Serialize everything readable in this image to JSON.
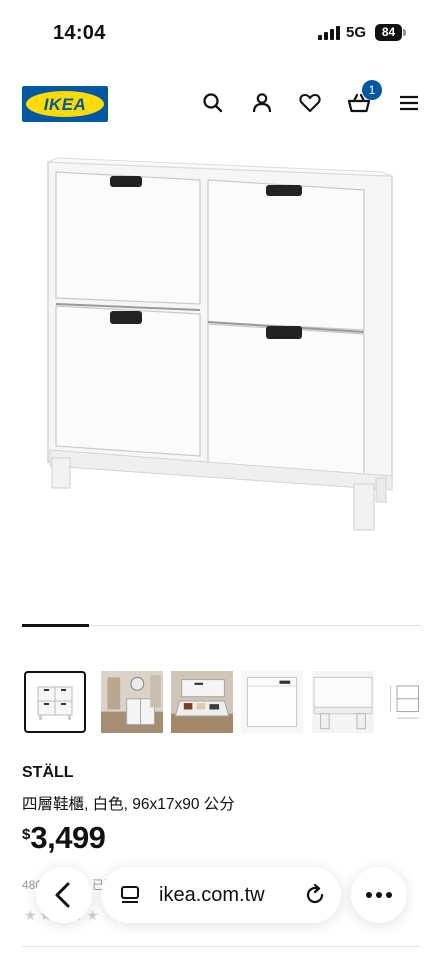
{
  "status_bar": {
    "time": "14:04",
    "network": "5G",
    "battery": "84"
  },
  "header": {
    "logo_text": "IKEA",
    "cart_count": "1",
    "icons": [
      "search-icon",
      "account-icon",
      "heart-icon",
      "basket-icon",
      "menu-icon"
    ]
  },
  "gallery": {
    "position": 1,
    "count": 6,
    "thumbnails": [
      "product-front",
      "room-hallway",
      "drawer-open-shoes",
      "drawer-closeup",
      "leg-closeup",
      "dimensions-drawing"
    ]
  },
  "product": {
    "name": "STÄLL",
    "description": "四層鞋櫃, 白色, 96x17x90 公分",
    "currency": "$",
    "price": "3,499",
    "review_text": "480 則評論 · 已購買",
    "stars": "★★★★★"
  },
  "browser": {
    "url": "ikea.com.tw"
  },
  "colors": {
    "brand_blue": "#0058a3",
    "brand_yellow": "#ffdb00",
    "text": "#111111"
  }
}
